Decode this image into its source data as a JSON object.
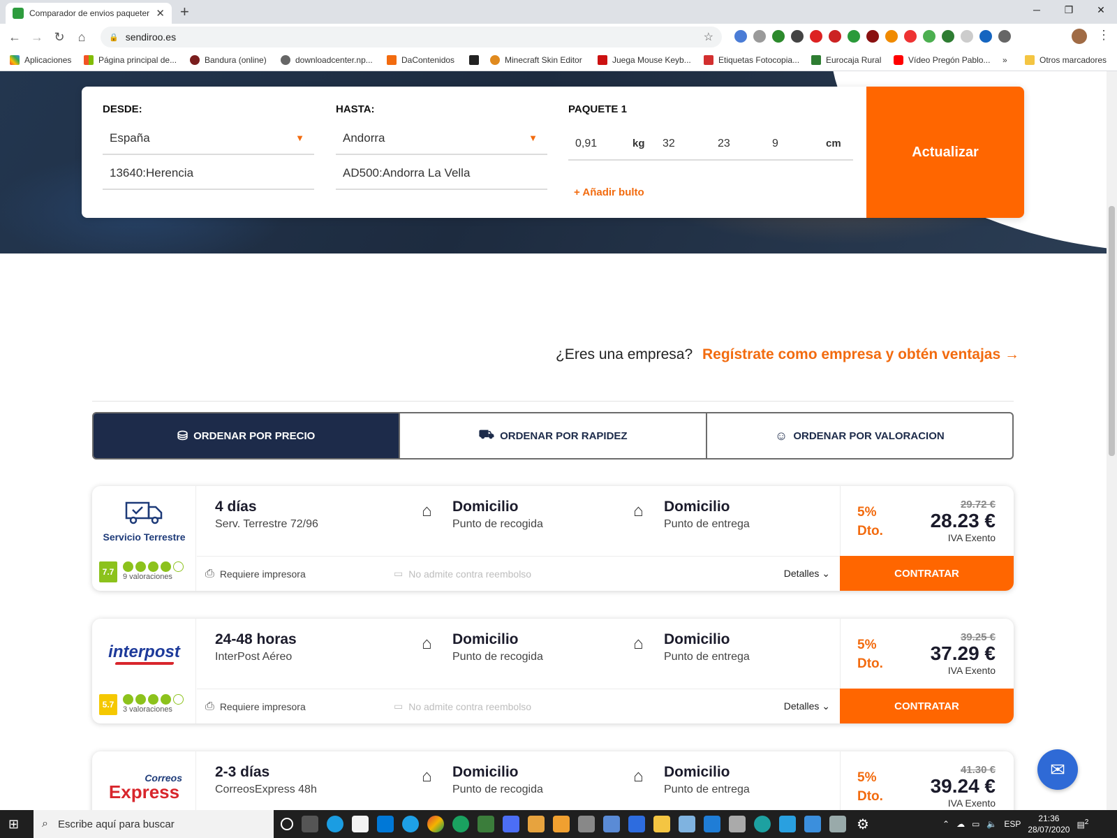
{
  "browser": {
    "tab_title": "Comparador de envios paqueter",
    "url": "sendiroo.es",
    "bookmarks": [
      "Aplicaciones",
      "Página principal de...",
      "Bandura (online)",
      "downloadcenter.np...",
      "DaContenidos",
      "Minecraft Skin Editor",
      "Juega Mouse Keyb...",
      "Etiquetas Fotocopia...",
      "Eurocaja Rural",
      "Vídeo Pregón Pablo...",
      "Otros marcadores"
    ],
    "bookmark_overflow": "»"
  },
  "search": {
    "desde_label": "DESDE:",
    "hasta_label": "HASTA:",
    "paquete_label": "PAQUETE 1",
    "from_country": "España",
    "from_postal": "13640:Herencia",
    "to_country": "Andorra",
    "to_postal": "AD500:Andorra La Vella",
    "weight": "0,91",
    "weight_unit": "kg",
    "length": "32",
    "width": "23",
    "height": "9",
    "dim_unit": "cm",
    "add_parcel": "+ Añadir bulto",
    "update_button": "Actualizar"
  },
  "company": {
    "question": "¿Eres una empresa?",
    "link": "Regístrate como empresa y obtén ventajas"
  },
  "sort": {
    "price": "ORDENAR POR PRECIO",
    "speed": "ORDENAR POR RAPIDEZ",
    "rating": "ORDENAR POR VALORACION"
  },
  "offers": [
    {
      "logo_text": "Servicio Terrestre",
      "score": "7.7",
      "score_color": "#8cc21c",
      "stars_filled": 4,
      "reviews": "9 valoraciones",
      "days": "4 días",
      "service": "Serv. Terrestre 72/96",
      "pickup": "Domicilio",
      "pickup_sub": "Punto de recogida",
      "delivery": "Domicilio",
      "delivery_sub": "Punto de entrega",
      "requires": "Requiere impresora",
      "cod": "No admite contra reembolso",
      "details": "Detalles",
      "discount_pct": "5%",
      "discount_word": "Dto.",
      "old_price": "29.72 €",
      "price": "28.23 €",
      "tax": "IVA Exento",
      "cta": "CONTRATAR"
    },
    {
      "logo_text": "interpost",
      "score": "5.7",
      "score_color": "#f5c800",
      "stars_filled": 4,
      "reviews": "3 valoraciones",
      "days": "24-48 horas",
      "service": "InterPost Aéreo",
      "pickup": "Domicilio",
      "pickup_sub": "Punto de recogida",
      "delivery": "Domicilio",
      "delivery_sub": "Punto de entrega",
      "requires": "Requiere impresora",
      "cod": "No admite contra reembolso",
      "details": "Detalles",
      "discount_pct": "5%",
      "discount_word": "Dto.",
      "old_price": "39.25 €",
      "price": "37.29 €",
      "tax": "IVA Exento",
      "cta": "CONTRATAR"
    },
    {
      "logo_text_top": "Correos",
      "logo_text_bottom": "Express",
      "days": "2-3 días",
      "service": "CorreosExpress 48h",
      "pickup": "Domicilio",
      "pickup_sub": "Punto de recogida",
      "delivery": "Domicilio",
      "delivery_sub": "Punto de entrega",
      "discount_pct": "5%",
      "discount_word": "Dto.",
      "old_price": "41.30 €",
      "price": "39.24 €",
      "tax": "IVA Exento"
    }
  ],
  "taskbar": {
    "search_placeholder": "Escribe aquí para buscar",
    "lang": "ESP",
    "time": "21:36",
    "date": "28/07/2020",
    "notifications": "2"
  },
  "colors": {
    "accent_orange": "#ff6600",
    "navy": "#1d2b4a",
    "rating_green": "#8cc21c"
  }
}
